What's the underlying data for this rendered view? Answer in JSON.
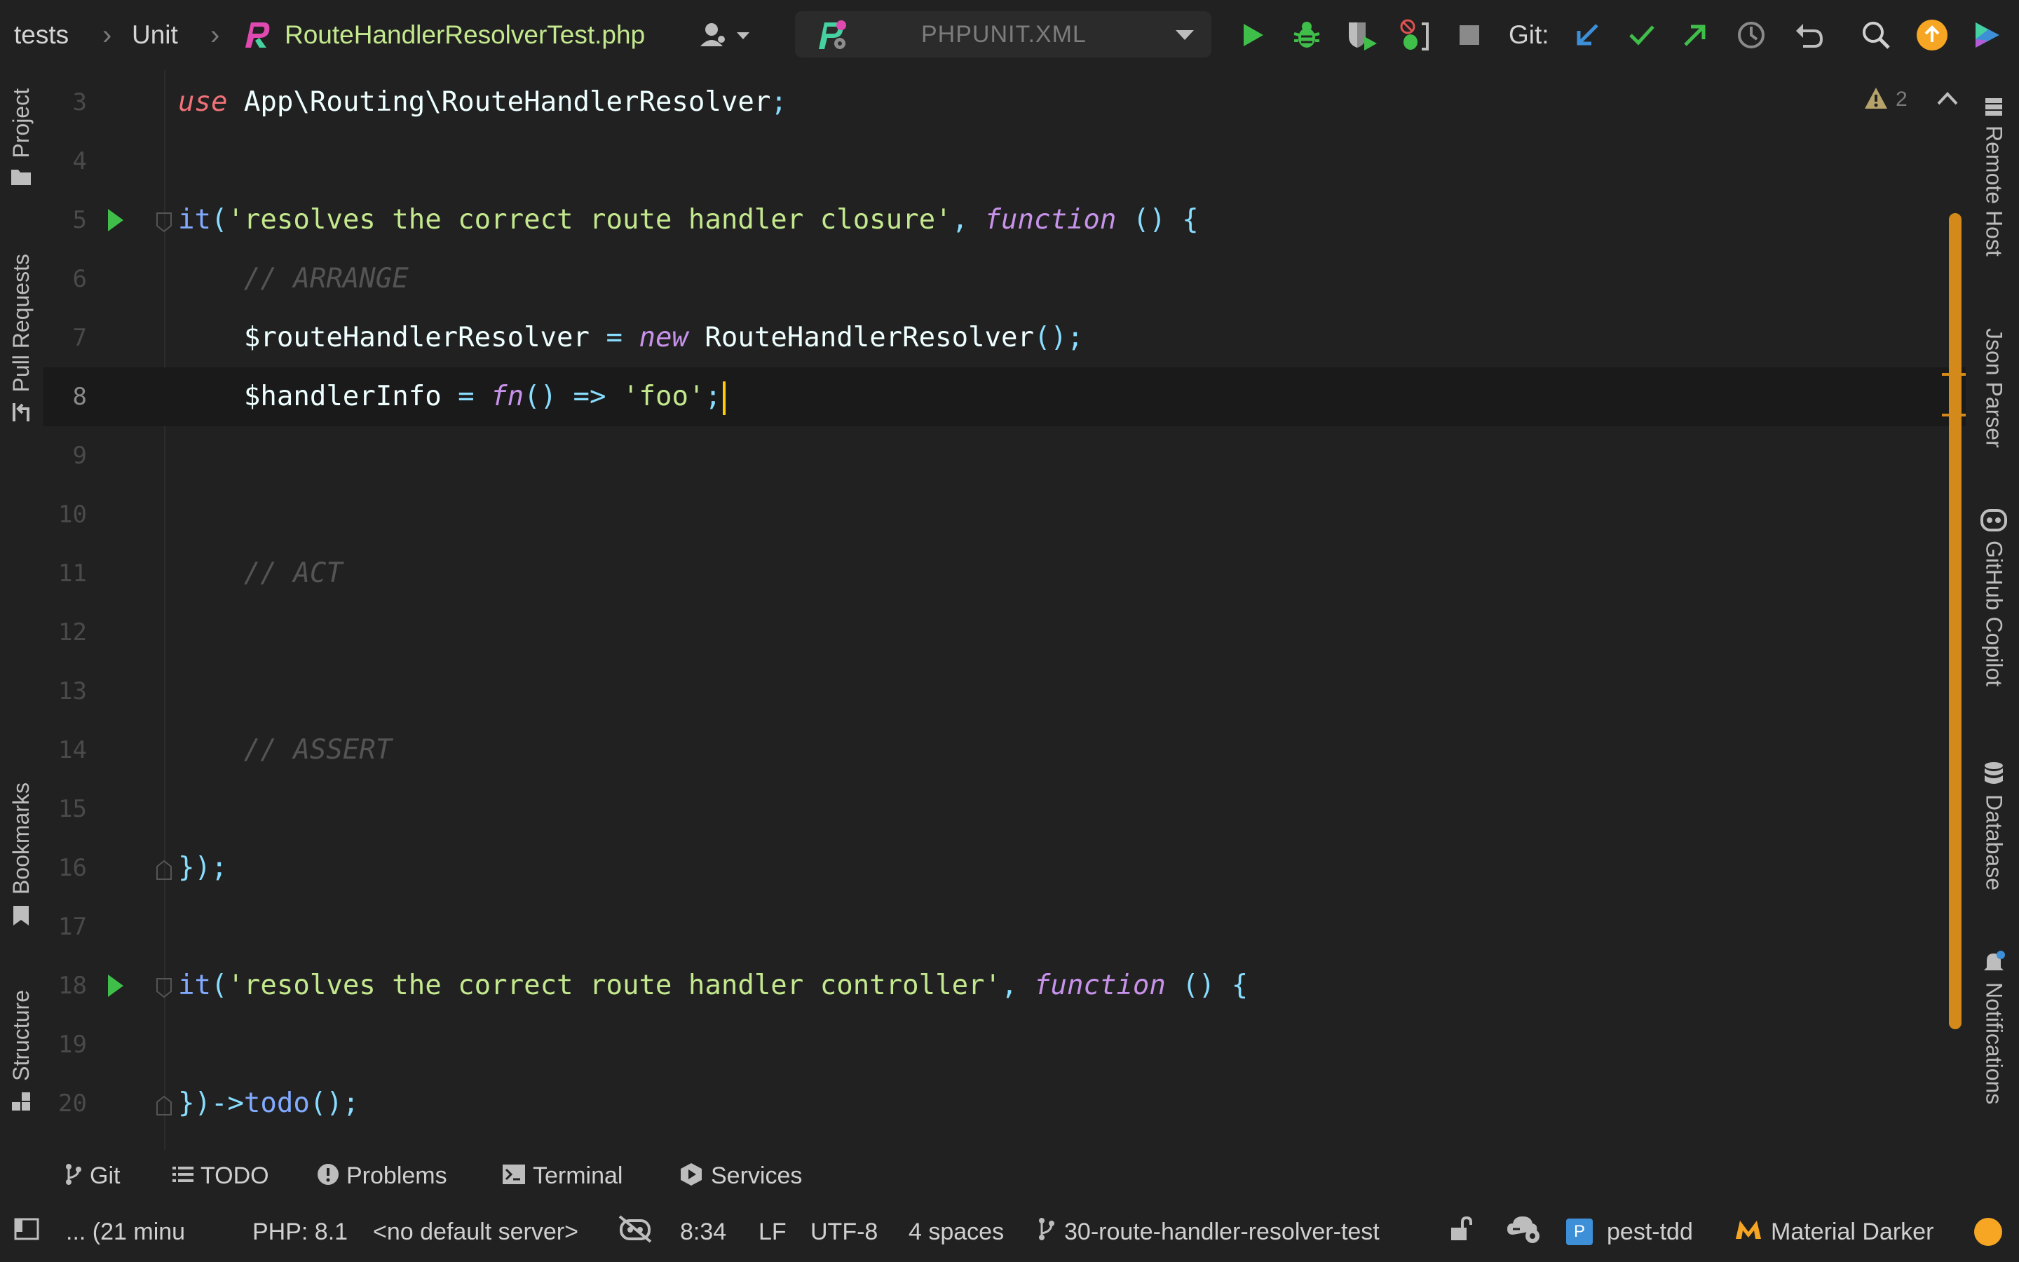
{
  "navbar": {
    "breadcrumb_tests": "tests",
    "breadcrumb_unit": "Unit",
    "breadcrumb_file": "RouteHandlerResolverTest.php",
    "run_config": "PHPUNIT.XML",
    "git_label": "Git:"
  },
  "left_tools": {
    "project": "Project",
    "pull_requests": "Pull Requests",
    "bookmarks": "Bookmarks",
    "structure": "Structure"
  },
  "right_tools": {
    "remote_host": "Remote Host",
    "json_parser": "Json Parser",
    "github_copilot": "GitHub Copilot",
    "database": "Database",
    "notifications": "Notifications"
  },
  "editor": {
    "problems_count": "2",
    "lines": {
      "n3": "3",
      "n4": "4",
      "n5": "5",
      "n6": "6",
      "n7": "7",
      "n8": "8",
      "n9": "9",
      "n10": "10",
      "n11": "11",
      "n12": "12",
      "n13": "13",
      "n14": "14",
      "n15": "15",
      "n16": "16",
      "n17": "17",
      "n18": "18",
      "n19": "19",
      "n20": "20"
    },
    "tokens": {
      "use_kw": "use",
      "use_path": " App\\Routing\\RouteHandlerResolver",
      "semi": ";",
      "it1_fn": "it",
      "paren_open": "(",
      "it1_str": "'resolves the correct route handler closure'",
      "comma": ", ",
      "function_kw": "function",
      "fn_sig": " () {",
      "indent": "    ",
      "comment_arrange": "// ARRANGE",
      "var_resolver": "$routeHandlerResolver",
      "assign": " = ",
      "new_kw": "new",
      "class_name": " RouteHandlerResolver",
      "call_parens": "();",
      "var_handler": "$handlerInfo",
      "fn_kw": "fn",
      "arrow": "() => ",
      "foo_str": "'foo'",
      "comment_act": "// ACT",
      "comment_assert": "// ASSERT",
      "close_block": "});",
      "it2_str": "'resolves the correct route handler controller'",
      "close_todo": "})->",
      "todo_fn": "todo",
      "todo_end": "();"
    }
  },
  "bottom_tabs": {
    "git": "Git",
    "todo": "TODO",
    "problems": "Problems",
    "terminal": "Terminal",
    "services": "Services"
  },
  "status": {
    "progress": "... (21 minu",
    "php_version": "PHP: 8.1",
    "server": "<no default server>",
    "cursor_pos": "8:34",
    "line_sep": "LF",
    "encoding": "UTF-8",
    "indent": "4 spaces",
    "branch": "30-route-handler-resolver-test",
    "project_badge": "P",
    "project": "pest-tdd",
    "theme": "Material Darker"
  },
  "colors": {
    "background": "#212121",
    "keyword": "#f07178",
    "function": "#82aaff",
    "string": "#c3e88d",
    "punctuation": "#89ddff",
    "italic_keyword": "#c792ea",
    "comment": "#545454",
    "run_green": "#3fbf4a",
    "caret": "#ffcc00",
    "scroll_marker": "#d38a1a"
  }
}
